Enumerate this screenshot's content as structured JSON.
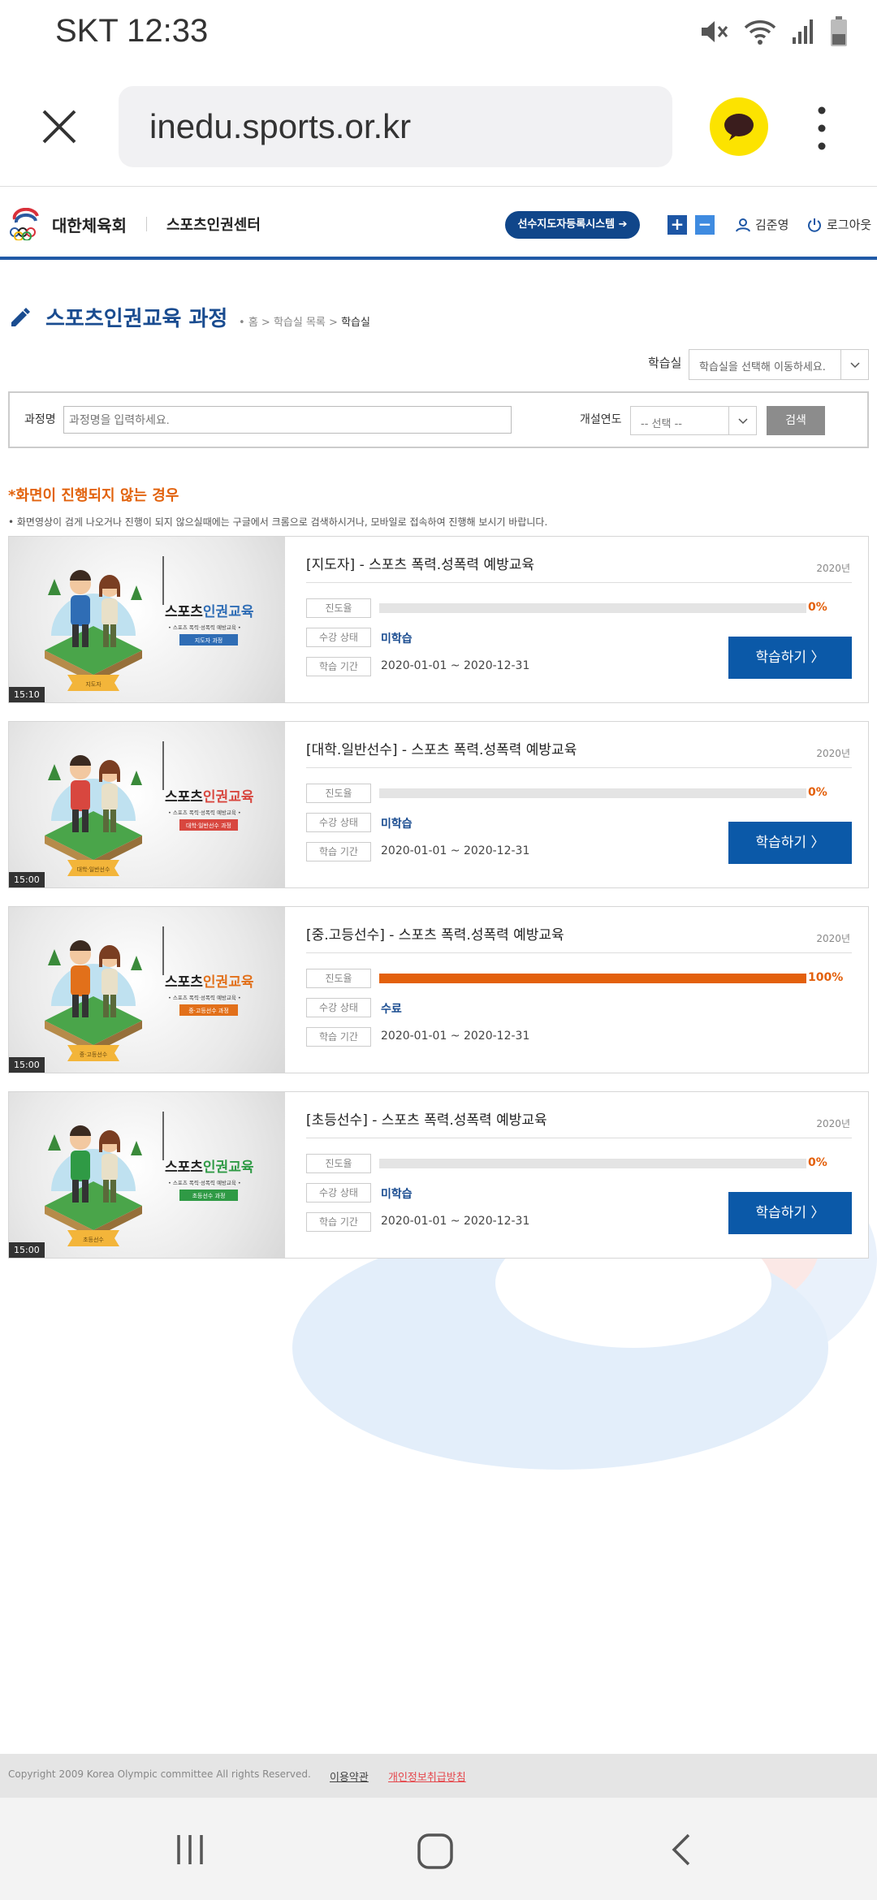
{
  "status_bar": {
    "carrier_time": "SKT 12:33",
    "icons": [
      "mute-icon",
      "wifi-icon",
      "signal-icon",
      "battery-icon"
    ]
  },
  "browser": {
    "url": "inedu.sports.or.kr"
  },
  "site_header": {
    "org_name": "대한체육회",
    "center_name": "스포츠인권센터",
    "register_button": "선수지도자등록시스템",
    "zoom_in": "+",
    "zoom_out": "−",
    "user_name": "김준영",
    "logout": "로그아웃"
  },
  "page": {
    "title": "스포츠인권교육 과정",
    "breadcrumb": {
      "home": "홈",
      "list": "학습실 목록",
      "current": "학습실"
    },
    "room_label": "학습실",
    "room_placeholder": "학습실을 선택해 이동하세요."
  },
  "search": {
    "course_label": "과정명",
    "course_placeholder": "과정명을 입력하세요.",
    "year_label": "개설연도",
    "year_select": "-- 선택 --",
    "button": "검색"
  },
  "notice": {
    "title": "*화면이 진행되지 않는 경우",
    "text": "• 화면영상이 검게 나오거나 진행이 되지 않으실때에는 구글에서 크롬으로 검색하시거나, 모바일로 접속하여 진행해 보시기 바랍니다."
  },
  "row_labels": {
    "progress": "진도율",
    "status": "수강 상태",
    "period": "학습 기간"
  },
  "courses": [
    {
      "title": "[지도자] - 스포츠 폭력.성폭력 예방교육",
      "year": "2020년",
      "progress_pct": "0%",
      "progress": 0,
      "status": "미학습",
      "period": "2020-01-01 ~ 2020-12-31",
      "button": "학습하기 〉",
      "duration": "15:10",
      "thumb_title": "스포츠인권교육",
      "thumb_sub": "• 스포츠 폭력·성폭력 예방교육 •",
      "thumb_ribbon": "지도자 과정",
      "thumb_badge": "지도자",
      "accent": "#2f6db5"
    },
    {
      "title": "[대학.일반선수] - 스포츠 폭력.성폭력 예방교육",
      "year": "2020년",
      "progress_pct": "0%",
      "progress": 0,
      "status": "미학습",
      "period": "2020-01-01 ~ 2020-12-31",
      "button": "학습하기 〉",
      "duration": "15:00",
      "thumb_title": "스포츠인권교육",
      "thumb_sub": "• 스포츠 폭력·성폭력 예방교육 •",
      "thumb_ribbon": "대학·일반선수 과정",
      "thumb_badge": "대학·일반선수",
      "accent": "#d8473f"
    },
    {
      "title": "[중.고등선수] - 스포츠 폭력.성폭력 예방교육",
      "year": "2020년",
      "progress_pct": "100%",
      "progress": 100,
      "status": "수료",
      "period": "2020-01-01 ~ 2020-12-31",
      "button": "",
      "duration": "15:00",
      "thumb_title": "스포츠인권교육",
      "thumb_sub": "• 스포츠 폭력·성폭력 예방교육 •",
      "thumb_ribbon": "중·고등선수 과정",
      "thumb_badge": "중·고등선수",
      "accent": "#e2701a"
    },
    {
      "title": "[초등선수] - 스포츠 폭력.성폭력 예방교육",
      "year": "2020년",
      "progress_pct": "0%",
      "progress": 0,
      "status": "미학습",
      "period": "2020-01-01 ~ 2020-12-31",
      "button": "학습하기 〉",
      "duration": "15:00",
      "thumb_title": "스포츠인권교육",
      "thumb_sub": "• 스포츠 폭력·성폭력 예방교육 •",
      "thumb_ribbon": "초등선수 과정",
      "thumb_badge": "초등선수",
      "accent": "#2f9a45"
    }
  ],
  "footer": {
    "copyright": "Copyright 2009 Korea Olympic committee All rights Reserved.",
    "terms": "이용약관",
    "privacy": "개인정보취급방침"
  },
  "nav_bar": {
    "icons": [
      "recent-apps-icon",
      "home-icon",
      "back-icon"
    ]
  }
}
